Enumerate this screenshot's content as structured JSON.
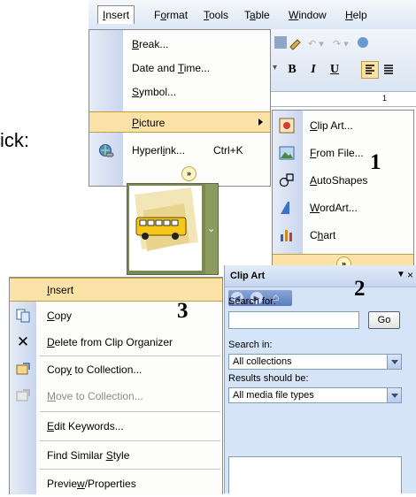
{
  "side_text": "ick:",
  "callouts": {
    "one": "1",
    "two": "2",
    "three": "3"
  },
  "menubar": {
    "items": [
      {
        "pre": "",
        "key": "I",
        "post": "nsert"
      },
      {
        "pre": "F",
        "key": "o",
        "post": "rmat"
      },
      {
        "pre": "",
        "key": "T",
        "post": "ools"
      },
      {
        "pre": "T",
        "key": "a",
        "post": "ble"
      },
      {
        "pre": "",
        "key": "W",
        "post": "indow"
      },
      {
        "pre": "",
        "key": "H",
        "post": "elp"
      }
    ]
  },
  "insert_menu": {
    "break": {
      "pre": "",
      "key": "B",
      "post": "reak..."
    },
    "date_time": {
      "pre": "Date and ",
      "key": "T",
      "post": "ime..."
    },
    "symbol": {
      "pre": "",
      "key": "S",
      "post": "ymbol..."
    },
    "picture": {
      "pre": "",
      "key": "P",
      "post": "icture"
    },
    "hyperlink": {
      "pre": "Hyperl",
      "key": "i",
      "post": "nk...",
      "shortcut": "Ctrl+K"
    }
  },
  "toolbar": {
    "bold": "B",
    "italic": "I",
    "underline": "U",
    "ruler_mark": "1"
  },
  "picture_menu": {
    "clip_art": {
      "pre": "",
      "key": "C",
      "post": "lip Art..."
    },
    "from_file": {
      "pre": "",
      "key": "F",
      "post": "rom File..."
    },
    "autoshapes": {
      "pre": "",
      "key": "A",
      "post": "utoShapes"
    },
    "wordart": {
      "pre": "",
      "key": "W",
      "post": "ordArt..."
    },
    "chart": {
      "pre": "C",
      "key": "h",
      "post": "art"
    }
  },
  "task_pane": {
    "title": "Clip Art",
    "search_for_label": "Search for:",
    "search_value": "",
    "go_label": "Go",
    "search_in_label": "Search in:",
    "search_in_value": "All collections",
    "results_label": "Results should be:",
    "results_value": "All media file types"
  },
  "context_menu": {
    "insert": {
      "pre": "",
      "key": "I",
      "post": "nsert"
    },
    "copy": {
      "pre": "",
      "key": "C",
      "post": "opy"
    },
    "delete": {
      "pre": "",
      "key": "D",
      "post": "elete from Clip Organizer"
    },
    "copy_to": {
      "pre": "Cop",
      "key": "y",
      "post": " to Collection..."
    },
    "move_to": {
      "pre": "",
      "key": "M",
      "post": "ove to Collection..."
    },
    "edit_keywords": {
      "pre": "",
      "key": "E",
      "post": "dit Keywords..."
    },
    "find_similar": {
      "pre": "Find Similar ",
      "key": "S",
      "post": "tyle"
    },
    "preview": {
      "pre": "Previe",
      "key": "w",
      "post": "/Properties"
    }
  },
  "colors": {
    "highlight": "#fbe2a6",
    "pane_bg": "#d6e4f7",
    "menu_gutter": "#c9d6ee"
  }
}
